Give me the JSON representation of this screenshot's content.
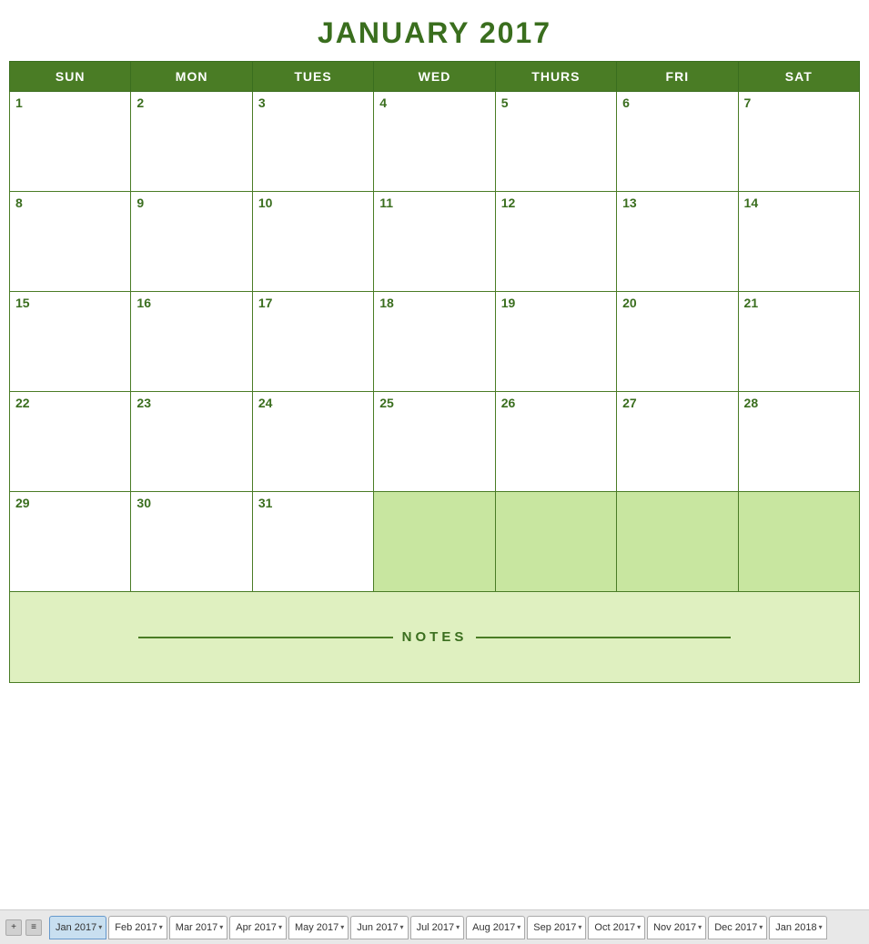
{
  "title": "JANUARY 2017",
  "days_of_week": [
    "SUN",
    "MON",
    "TUES",
    "WED",
    "THURS",
    "FRI",
    "SAT"
  ],
  "weeks": [
    [
      {
        "day": "1",
        "type": "current"
      },
      {
        "day": "2",
        "type": "current"
      },
      {
        "day": "3",
        "type": "current"
      },
      {
        "day": "4",
        "type": "current"
      },
      {
        "day": "5",
        "type": "current"
      },
      {
        "day": "6",
        "type": "current"
      },
      {
        "day": "7",
        "type": "current"
      }
    ],
    [
      {
        "day": "8",
        "type": "current"
      },
      {
        "day": "9",
        "type": "current"
      },
      {
        "day": "10",
        "type": "current"
      },
      {
        "day": "11",
        "type": "current"
      },
      {
        "day": "12",
        "type": "current"
      },
      {
        "day": "13",
        "type": "current"
      },
      {
        "day": "14",
        "type": "current"
      }
    ],
    [
      {
        "day": "15",
        "type": "current"
      },
      {
        "day": "16",
        "type": "current"
      },
      {
        "day": "17",
        "type": "current"
      },
      {
        "day": "18",
        "type": "current"
      },
      {
        "day": "19",
        "type": "current"
      },
      {
        "day": "20",
        "type": "current"
      },
      {
        "day": "21",
        "type": "current"
      }
    ],
    [
      {
        "day": "22",
        "type": "current"
      },
      {
        "day": "23",
        "type": "current"
      },
      {
        "day": "24",
        "type": "current"
      },
      {
        "day": "25",
        "type": "current"
      },
      {
        "day": "26",
        "type": "current"
      },
      {
        "day": "27",
        "type": "current"
      },
      {
        "day": "28",
        "type": "current"
      }
    ],
    [
      {
        "day": "29",
        "type": "current"
      },
      {
        "day": "30",
        "type": "current"
      },
      {
        "day": "31",
        "type": "current"
      },
      {
        "day": "",
        "type": "next-month"
      },
      {
        "day": "",
        "type": "next-month"
      },
      {
        "day": "",
        "type": "next-month"
      },
      {
        "day": "",
        "type": "next-month"
      }
    ]
  ],
  "notes_label": "NOTES",
  "tabs": [
    {
      "label": "Jan 2017",
      "active": true
    },
    {
      "label": "Feb 2017",
      "active": false
    },
    {
      "label": "Mar 2017",
      "active": false
    },
    {
      "label": "Apr 2017",
      "active": false
    },
    {
      "label": "May 2017",
      "active": false
    },
    {
      "label": "Jun 2017",
      "active": false
    },
    {
      "label": "Jul 2017",
      "active": false
    },
    {
      "label": "Aug 2017",
      "active": false
    },
    {
      "label": "Sep 2017",
      "active": false
    },
    {
      "label": "Oct 2017",
      "active": false
    },
    {
      "label": "Nov 2017",
      "active": false
    },
    {
      "label": "Dec 2017",
      "active": false
    },
    {
      "label": "Jan 2018",
      "active": false
    }
  ],
  "colors": {
    "header_bg": "#4a7c25",
    "header_text": "#ffffff",
    "title_text": "#3a6e1e",
    "day_number": "#3a6e1e",
    "border": "#4a7c25",
    "next_month_bg": "#c8e6a0",
    "notes_bg": "#dff0c0"
  }
}
